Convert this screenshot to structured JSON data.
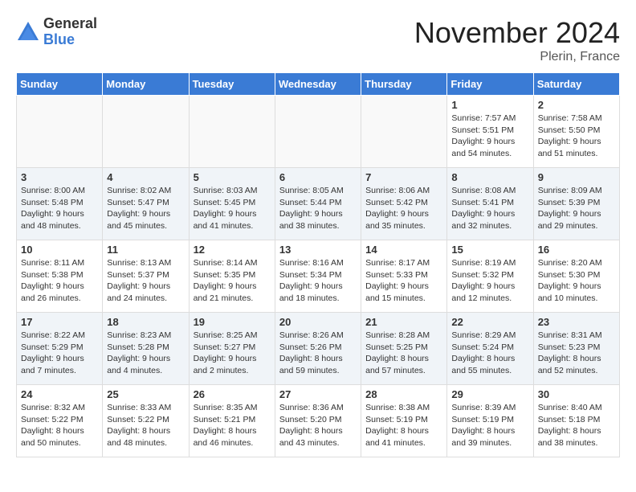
{
  "logo": {
    "general": "General",
    "blue": "Blue"
  },
  "title": "November 2024",
  "location": "Plerin, France",
  "days_of_week": [
    "Sunday",
    "Monday",
    "Tuesday",
    "Wednesday",
    "Thursday",
    "Friday",
    "Saturday"
  ],
  "weeks": [
    [
      {
        "day": "",
        "info": ""
      },
      {
        "day": "",
        "info": ""
      },
      {
        "day": "",
        "info": ""
      },
      {
        "day": "",
        "info": ""
      },
      {
        "day": "",
        "info": ""
      },
      {
        "day": "1",
        "info": "Sunrise: 7:57 AM\nSunset: 5:51 PM\nDaylight: 9 hours and 54 minutes."
      },
      {
        "day": "2",
        "info": "Sunrise: 7:58 AM\nSunset: 5:50 PM\nDaylight: 9 hours and 51 minutes."
      }
    ],
    [
      {
        "day": "3",
        "info": "Sunrise: 8:00 AM\nSunset: 5:48 PM\nDaylight: 9 hours and 48 minutes."
      },
      {
        "day": "4",
        "info": "Sunrise: 8:02 AM\nSunset: 5:47 PM\nDaylight: 9 hours and 45 minutes."
      },
      {
        "day": "5",
        "info": "Sunrise: 8:03 AM\nSunset: 5:45 PM\nDaylight: 9 hours and 41 minutes."
      },
      {
        "day": "6",
        "info": "Sunrise: 8:05 AM\nSunset: 5:44 PM\nDaylight: 9 hours and 38 minutes."
      },
      {
        "day": "7",
        "info": "Sunrise: 8:06 AM\nSunset: 5:42 PM\nDaylight: 9 hours and 35 minutes."
      },
      {
        "day": "8",
        "info": "Sunrise: 8:08 AM\nSunset: 5:41 PM\nDaylight: 9 hours and 32 minutes."
      },
      {
        "day": "9",
        "info": "Sunrise: 8:09 AM\nSunset: 5:39 PM\nDaylight: 9 hours and 29 minutes."
      }
    ],
    [
      {
        "day": "10",
        "info": "Sunrise: 8:11 AM\nSunset: 5:38 PM\nDaylight: 9 hours and 26 minutes."
      },
      {
        "day": "11",
        "info": "Sunrise: 8:13 AM\nSunset: 5:37 PM\nDaylight: 9 hours and 24 minutes."
      },
      {
        "day": "12",
        "info": "Sunrise: 8:14 AM\nSunset: 5:35 PM\nDaylight: 9 hours and 21 minutes."
      },
      {
        "day": "13",
        "info": "Sunrise: 8:16 AM\nSunset: 5:34 PM\nDaylight: 9 hours and 18 minutes."
      },
      {
        "day": "14",
        "info": "Sunrise: 8:17 AM\nSunset: 5:33 PM\nDaylight: 9 hours and 15 minutes."
      },
      {
        "day": "15",
        "info": "Sunrise: 8:19 AM\nSunset: 5:32 PM\nDaylight: 9 hours and 12 minutes."
      },
      {
        "day": "16",
        "info": "Sunrise: 8:20 AM\nSunset: 5:30 PM\nDaylight: 9 hours and 10 minutes."
      }
    ],
    [
      {
        "day": "17",
        "info": "Sunrise: 8:22 AM\nSunset: 5:29 PM\nDaylight: 9 hours and 7 minutes."
      },
      {
        "day": "18",
        "info": "Sunrise: 8:23 AM\nSunset: 5:28 PM\nDaylight: 9 hours and 4 minutes."
      },
      {
        "day": "19",
        "info": "Sunrise: 8:25 AM\nSunset: 5:27 PM\nDaylight: 9 hours and 2 minutes."
      },
      {
        "day": "20",
        "info": "Sunrise: 8:26 AM\nSunset: 5:26 PM\nDaylight: 8 hours and 59 minutes."
      },
      {
        "day": "21",
        "info": "Sunrise: 8:28 AM\nSunset: 5:25 PM\nDaylight: 8 hours and 57 minutes."
      },
      {
        "day": "22",
        "info": "Sunrise: 8:29 AM\nSunset: 5:24 PM\nDaylight: 8 hours and 55 minutes."
      },
      {
        "day": "23",
        "info": "Sunrise: 8:31 AM\nSunset: 5:23 PM\nDaylight: 8 hours and 52 minutes."
      }
    ],
    [
      {
        "day": "24",
        "info": "Sunrise: 8:32 AM\nSunset: 5:22 PM\nDaylight: 8 hours and 50 minutes."
      },
      {
        "day": "25",
        "info": "Sunrise: 8:33 AM\nSunset: 5:22 PM\nDaylight: 8 hours and 48 minutes."
      },
      {
        "day": "26",
        "info": "Sunrise: 8:35 AM\nSunset: 5:21 PM\nDaylight: 8 hours and 46 minutes."
      },
      {
        "day": "27",
        "info": "Sunrise: 8:36 AM\nSunset: 5:20 PM\nDaylight: 8 hours and 43 minutes."
      },
      {
        "day": "28",
        "info": "Sunrise: 8:38 AM\nSunset: 5:19 PM\nDaylight: 8 hours and 41 minutes."
      },
      {
        "day": "29",
        "info": "Sunrise: 8:39 AM\nSunset: 5:19 PM\nDaylight: 8 hours and 39 minutes."
      },
      {
        "day": "30",
        "info": "Sunrise: 8:40 AM\nSunset: 5:18 PM\nDaylight: 8 hours and 38 minutes."
      }
    ]
  ]
}
